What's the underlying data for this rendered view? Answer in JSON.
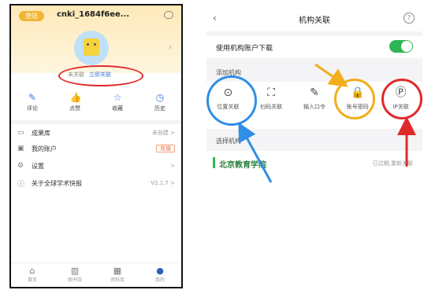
{
  "left_screen": {
    "vip_badge": "登陆",
    "username": "cnki_1684f6ee...",
    "link_status": "未关联",
    "link_action": "立即关联",
    "quick_actions": [
      {
        "label": "评论",
        "icon": "pen-icon"
      },
      {
        "label": "点赞",
        "icon": "thumb-icon"
      },
      {
        "label": "收藏",
        "icon": "star-icon"
      },
      {
        "label": "历史",
        "icon": "clock-icon"
      }
    ],
    "menu": [
      {
        "label": "成果库",
        "right": "未创建 >",
        "icon": "folder-icon"
      },
      {
        "label": "我的账户",
        "right": "充值",
        "icon": "wallet-icon"
      },
      {
        "label": "设置",
        "right": ">",
        "icon": "gear-icon"
      },
      {
        "label": "关于全球学术快报",
        "right": "V2.1.7 >",
        "icon": "info-icon"
      }
    ],
    "tabs": [
      {
        "label": "首页",
        "icon": "home-icon"
      },
      {
        "label": "图书馆",
        "icon": "book-icon"
      },
      {
        "label": "资料库",
        "icon": "building-icon"
      },
      {
        "label": "我的",
        "icon": "user-icon"
      }
    ]
  },
  "right_screen": {
    "title": "机构关联",
    "download_label": "使用机构账户下载",
    "add_section": "添加机构",
    "methods": [
      {
        "label": "位置关联",
        "icon": "location-icon"
      },
      {
        "label": "扫码关联",
        "icon": "scan-icon"
      },
      {
        "label": "输入口令",
        "icon": "edit-icon"
      },
      {
        "label": "账号密码",
        "icon": "lock-icon"
      },
      {
        "label": "IP关联",
        "icon": "ip-icon"
      }
    ],
    "select_section": "选择机构",
    "institution": "北京教育学院",
    "institution_status": "已过期,重新关联"
  },
  "colors": {
    "red": "#e02a2a",
    "blue": "#2f8ee6",
    "orange": "#f2ae1b",
    "green": "#2fb553"
  }
}
